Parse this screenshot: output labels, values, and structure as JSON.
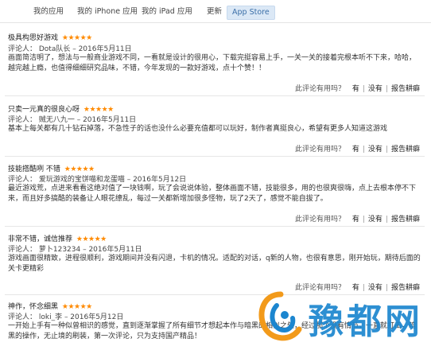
{
  "tabs": [
    {
      "label": "我的应用"
    },
    {
      "label": "我的 iPhone 应用"
    },
    {
      "label": "我的 iPad 应用"
    },
    {
      "label": "更新"
    },
    {
      "label": "App Store",
      "active": true
    }
  ],
  "reviews": [
    {
      "title": "极具构思好游戏",
      "stars": "★★★★★",
      "author": "评论人：  Dota队长 – 2016年5月11日",
      "body": "画面简洁明了，想法与一般商业游戏不同，一看就是设计的很用心，下载完挺容易上手，一关一关的接着完根本听不下来，哈哈，越完越上瘾，也值得细细研究品味，不错，今年发现的一款好游戏，点十个赞！！",
      "helpful": "此评论有用吗？",
      "yes": "有",
      "no": "没有",
      "report": "报告耕癖"
    },
    {
      "title": "只卖一元真的很良心呀",
      "stars": "★★★★★",
      "author": "评论人：  贼无八九一 – 2016年5月11日",
      "body": "基本上每关都有几十钻石掉落，不急性子的话也没什么必要充值都可以玩好，制作者真挺良心，希望有更多人知道这游戏",
      "helpful": "此评论有用吗？",
      "yes": "有",
      "no": "没有",
      "report": "报告耕癖"
    },
    {
      "title": "技能搭酷咧 不错",
      "stars": "★★★★★",
      "author": "评论人：  爱玩游戏的宝饼喵和龙蛋喵 – 2016年5月12日",
      "body": "最近游戏荒，点进来看看这绝对值了一块钱啊，玩了会说说体验，整体画面不错，技能很多，用的也很爽很嗨，点上去根本停不下来，而且好多搞酷的装备让人眼花缭乱，每过一关都新增加很多怪物，玩了2天了，感觉不能自拔了。",
      "helpful": "此评论有用吗？",
      "yes": "有",
      "no": "没有",
      "report": "报告耕癖"
    },
    {
      "title": "非常不错，诚信推荐",
      "stars": "★★★★★",
      "author": "评论人：  萝卜123234 – 2016年5月11日",
      "body": "游戏画面很精致，进程很顺利，游戏期间并没有闪退，卡机的情况。适配的对话，q新的人物，也很有意思，刚开始玩，期待后面的关卡更精彩",
      "helpful": "此评论有用吗？",
      "yes": "有",
      "no": "没有",
      "report": "报告耕癖"
    },
    {
      "title": "神作，怀念细黑",
      "stars": "★★★★★",
      "author": "评论人：  loki_李 – 2016年5月12日",
      "body": "一开始上手有一种似曾相识的感觉，直到逐渐掌握了所有细节才想起本作与暗黑的相似之处，经过那个没有情节，一直就打击，暗黑的操作，无止境的刷装，第一次评论，只为支持国产精品！",
      "helpful": "此评论有用吗？",
      "yes": "有",
      "no": "没有",
      "report": "报告耕癖"
    }
  ],
  "watermark": {
    "text": "豫都网",
    "color": "#1c86cf"
  }
}
